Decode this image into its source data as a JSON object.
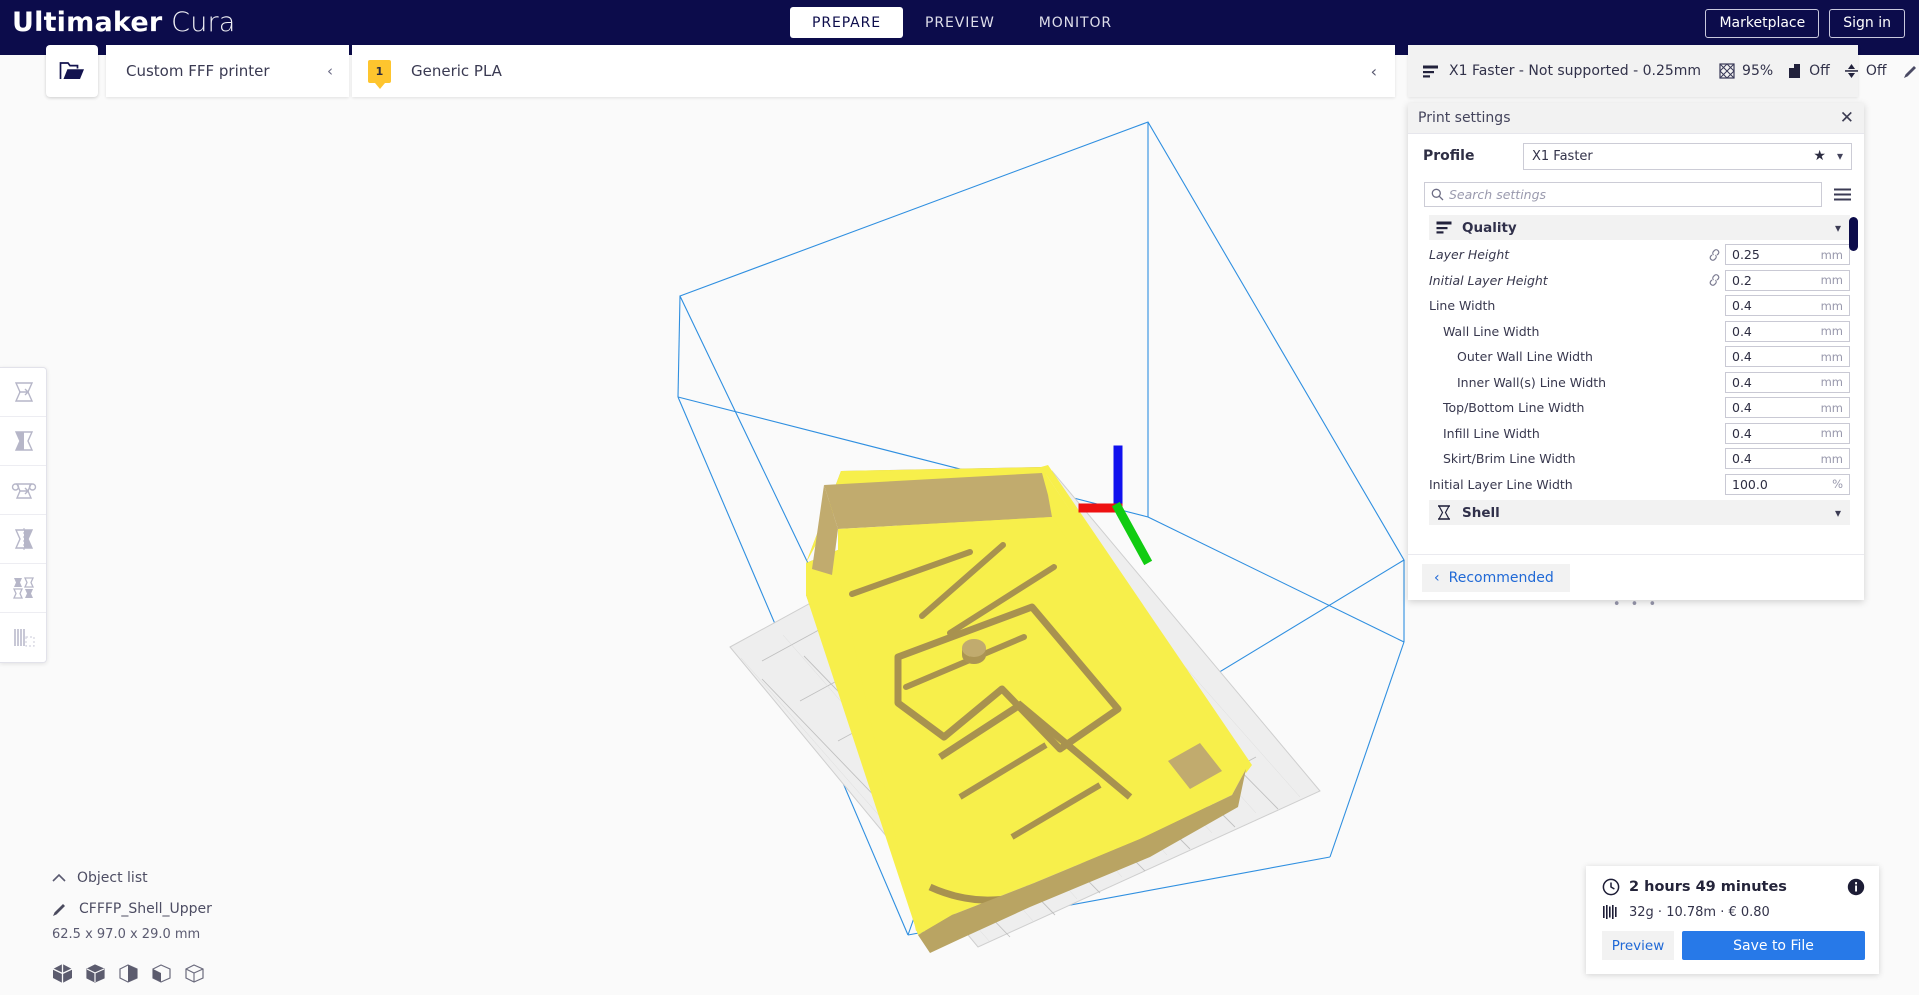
{
  "app": {
    "brand_bold": "Ultimaker",
    "brand_light": " Cura"
  },
  "header": {
    "tabs": [
      {
        "label": "PREPARE",
        "active": true
      },
      {
        "label": "PREVIEW",
        "active": false
      },
      {
        "label": "MONITOR",
        "active": false
      }
    ],
    "marketplace_label": "Marketplace",
    "signin_label": "Sign in"
  },
  "machine_bar": {
    "open_file_icon": "folder-open-icon",
    "printer_name": "Custom FFF printer",
    "printer_chevron": "chevron-left-icon",
    "extruder_number": "1",
    "material_name": "Generic PLA",
    "material_chevron": "chevron-left-icon"
  },
  "setup_bar": {
    "quality_icon": "layer-height-icon",
    "profile_summary": "X1 Faster - Not supported - 0.25mm",
    "infill_icon": "infill-icon",
    "infill_value": "95%",
    "support_icon": "support-icon",
    "support_value": "Off",
    "adhesion_icon": "adhesion-icon",
    "adhesion_value": "Off",
    "edit_icon": "pencil-icon"
  },
  "tools": [
    {
      "name": "move-tool",
      "icon": "move-icon"
    },
    {
      "name": "scale-tool",
      "icon": "scale-icon"
    },
    {
      "name": "rotate-tool",
      "icon": "rotate-icon"
    },
    {
      "name": "mirror-tool",
      "icon": "mirror-icon"
    },
    {
      "name": "per-model-settings-tool",
      "icon": "per-model-settings-icon"
    },
    {
      "name": "support-blocker-tool",
      "icon": "support-blocker-icon"
    }
  ],
  "object_list": {
    "collapse_icon": "chevron-up-icon",
    "title": "Object list",
    "item_icon": "pencil-icon",
    "item_name": "CFFFP_Shell_Upper",
    "dimensions": "62.5 x 97.0 x 29.0 mm",
    "view_icons": [
      "solid-view-icon",
      "xray-view-icon",
      "layer-view-icon",
      "wireframe-view-icon",
      "outline-view-icon"
    ]
  },
  "print_settings": {
    "title": "Print settings",
    "close_icon": "close-icon",
    "profile_label": "Profile",
    "profile_value": "X1 Faster",
    "profile_star_icon": "star-icon",
    "profile_chevron_icon": "chevron-down-icon",
    "search_placeholder": "Search settings",
    "search_value": "",
    "search_icon": "search-icon",
    "menu_icon": "hamburger-menu-icon",
    "categories": [
      {
        "name": "Quality",
        "icon": "quality-icon",
        "expanded": true,
        "chevron": "chevron-down-icon",
        "settings": [
          {
            "label": "Layer Height",
            "value": "0.25",
            "unit": "mm",
            "indent": 0,
            "modified": true,
            "linked": true
          },
          {
            "label": "Initial Layer Height",
            "value": "0.2",
            "unit": "mm",
            "indent": 0,
            "modified": true,
            "linked": true
          },
          {
            "label": "Line Width",
            "value": "0.4",
            "unit": "mm",
            "indent": 0,
            "modified": false,
            "linked": false
          },
          {
            "label": "Wall Line Width",
            "value": "0.4",
            "unit": "mm",
            "indent": 1,
            "modified": false,
            "linked": false
          },
          {
            "label": "Outer Wall Line Width",
            "value": "0.4",
            "unit": "mm",
            "indent": 2,
            "modified": false,
            "linked": false
          },
          {
            "label": "Inner Wall(s) Line Width",
            "value": "0.4",
            "unit": "mm",
            "indent": 2,
            "modified": false,
            "linked": false
          },
          {
            "label": "Top/Bottom Line Width",
            "value": "0.4",
            "unit": "mm",
            "indent": 1,
            "modified": false,
            "linked": false
          },
          {
            "label": "Infill Line Width",
            "value": "0.4",
            "unit": "mm",
            "indent": 1,
            "modified": false,
            "linked": false
          },
          {
            "label": "Skirt/Brim Line Width",
            "value": "0.4",
            "unit": "mm",
            "indent": 1,
            "modified": false,
            "linked": false
          },
          {
            "label": "Initial Layer Line Width",
            "value": "100.0",
            "unit": "%",
            "indent": 0,
            "modified": false,
            "linked": false
          }
        ]
      },
      {
        "name": "Shell",
        "icon": "shell-icon",
        "expanded": false,
        "chevron": "chevron-down-icon",
        "settings": []
      }
    ],
    "recommended_label": "Recommended",
    "recommended_chevron": "chevron-left-icon",
    "resize_grip": "• • •"
  },
  "job_info": {
    "time_icon": "clock-icon",
    "time": "2 hours 49 minutes",
    "info_icon": "info-icon",
    "material_icon": "filament-icon",
    "material_summary": "32g · 10.78m · € 0.80",
    "preview_label": "Preview",
    "save_label": "Save to File"
  },
  "colors": {
    "brand_navy": "#0c0c4b",
    "accent_blue": "#2779e8",
    "link_blue": "#2069d6",
    "extruder_yellow": "#fec52e",
    "model_yellow": "#f7ef4b",
    "buildplate_line": "#2f8fe0"
  },
  "viewport": {
    "model_name": "CFFFP_Shell_Upper",
    "axis_x_color": "#ee1111",
    "axis_y_color": "#11cc11",
    "axis_z_color": "#1111ee"
  }
}
